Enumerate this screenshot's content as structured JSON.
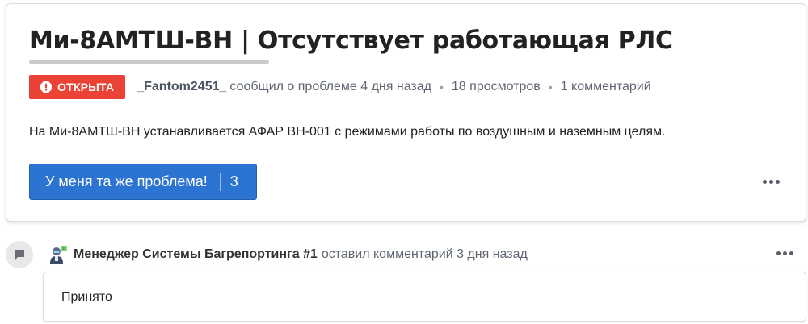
{
  "issue": {
    "title": "Ми-8АМТШ-ВН | Отсутствует работающая РЛС",
    "status": "ОТКРЫТА",
    "author": "_Fantom2451_",
    "reported_text": "сообщил о проблеме 4 дня назад",
    "views": "18 просмотров",
    "comments_count": "1 комментарий",
    "description": "На Ми-8АМТШ-ВН устанавливается АФАР ВН-001 с режимами работы по воздушным и наземным целям.",
    "same_issue_label": "У меня та же проблема!",
    "same_issue_count": "3"
  },
  "comment": {
    "author": "Менеджер Системы Багрепортинга #1",
    "action_text": "оставил комментарий 3 дня назад",
    "text": "Принято"
  },
  "colors": {
    "status_red": "#ea4335",
    "button_blue": "#2c74d2"
  },
  "icons": {
    "status": "alert-octagon-icon",
    "more": "more-horizontal-icon",
    "comment": "chat-bubble-icon",
    "avatar": "robot-avatar"
  }
}
